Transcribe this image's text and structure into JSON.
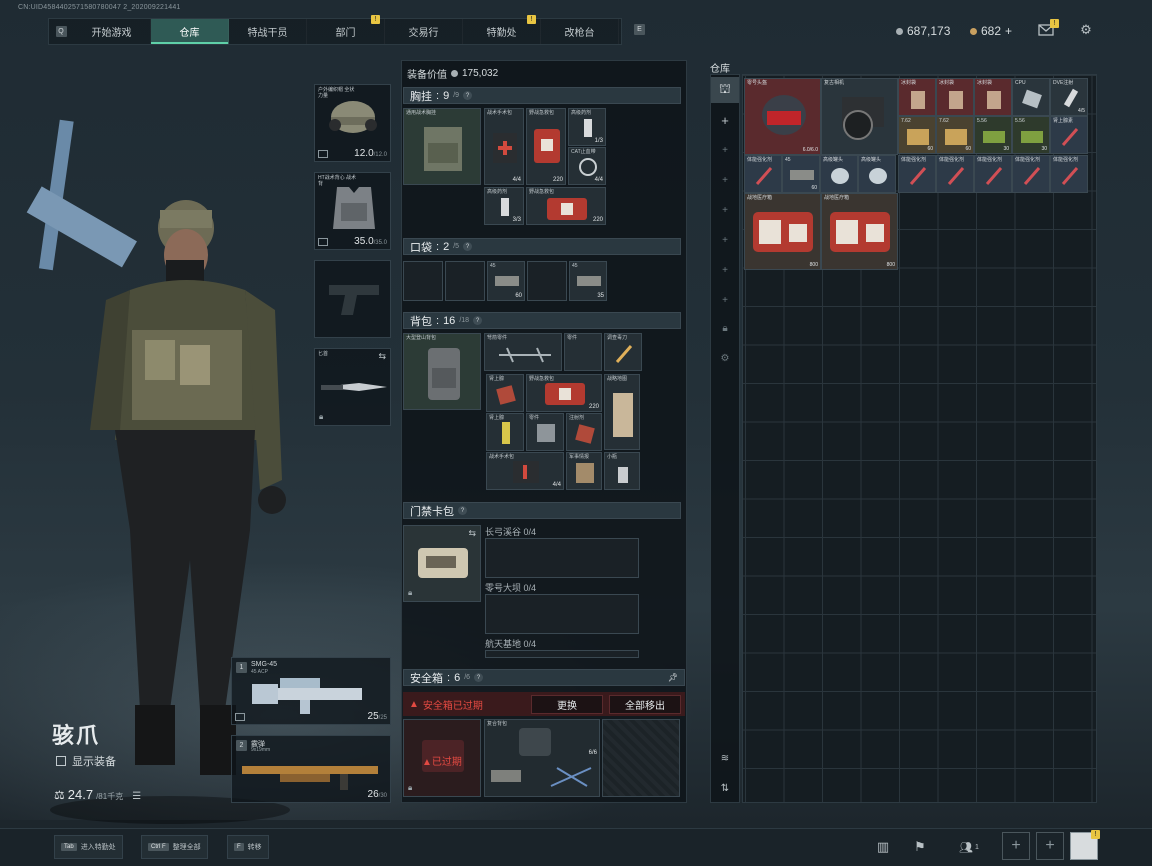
{
  "uid": "CN:UID4584402571580780047 2_202009221441",
  "nav": {
    "left_key": "Q",
    "right_key": "E",
    "tabs": [
      {
        "label": "开始游戏",
        "badge": ""
      },
      {
        "label": "仓库",
        "badge": ""
      },
      {
        "label": "特战干员",
        "badge": ""
      },
      {
        "label": "部门",
        "badge": "!"
      },
      {
        "label": "交易行",
        "badge": ""
      },
      {
        "label": "特勤处",
        "badge": "!"
      },
      {
        "label": "改枪台",
        "badge": ""
      }
    ],
    "active_tab": "仓库"
  },
  "currency": {
    "silver": "687,173",
    "gold": "682",
    "gold_plus": "+",
    "mail_badge": "!"
  },
  "character": {
    "name": "骇爪",
    "show_gear_label": "显示装备",
    "weight_current": "24.7",
    "weight_max": "/81千克"
  },
  "gear": {
    "helmet": {
      "label": "户外编织帽 全状力量",
      "value": "12.0",
      "max": "/12.0"
    },
    "armor": {
      "label": "HT战术背心 战术背",
      "value": "35.0",
      "max": "/35.0"
    },
    "melee": {
      "label": "匕首"
    },
    "primary": {
      "label": "SMG-45",
      "sub": "45 ACP",
      "ammo": "25",
      "max": "/25"
    },
    "secondary": {
      "label": "霰弹",
      "sub": "9x19mm",
      "ammo": "26",
      "max": "/30"
    }
  },
  "loadout": {
    "value_label": "装备价值",
    "value": "175,032",
    "chest": {
      "label": "胸挂",
      "count": "9",
      "max": "/9"
    },
    "pocket": {
      "label": "口袋",
      "count": "2",
      "max": "/5"
    },
    "backpack": {
      "label": "背包",
      "count": "16",
      "max": "/18"
    },
    "keycard": {
      "label": "门禁卡包"
    },
    "keys": [
      {
        "name": "长弓溪谷",
        "count": "0/4"
      },
      {
        "name": "零号大坝",
        "count": "0/4"
      },
      {
        "name": "航天基地",
        "count": "0/4"
      }
    ],
    "safebox": {
      "label": "安全箱",
      "count": "6",
      "max": "/6",
      "expired_msg": "安全箱已过期",
      "replace_btn": "更换",
      "move_all_btn": "全部移出",
      "expired_tag": "已过期"
    },
    "chest_items": [
      {
        "name": "通用战术胸挂",
        "n": ""
      },
      {
        "name": "战术手术包",
        "n": "4/4"
      },
      {
        "name": "野战急救包",
        "n": "220"
      },
      {
        "name": "高级药剂",
        "n": "1/3"
      },
      {
        "name": "CAT止血带",
        "n": "4/4"
      },
      {
        "name": "高级药剂",
        "n": "3/3"
      },
      {
        "name": "野战急救包",
        "n": "220"
      }
    ],
    "pocket_items": [
      {
        "name": "45",
        "n": "60"
      },
      {
        "name": "45",
        "n": "35"
      }
    ],
    "backpack_items": [
      {
        "name": "大型登山背包",
        "n": ""
      },
      {
        "name": "弩箭零件",
        "n": ""
      },
      {
        "name": "零件",
        "n": ""
      },
      {
        "name": "调查毒刀",
        "n": ""
      },
      {
        "name": "肾上腺",
        "n": ""
      },
      {
        "name": "野战急救包",
        "n": "220"
      },
      {
        "name": "战略地图",
        "n": ""
      },
      {
        "name": "肾上腺",
        "n": ""
      },
      {
        "name": "零件",
        "n": ""
      },
      {
        "name": "注射剂",
        "n": ""
      },
      {
        "name": "战术手术包",
        "n": "4/4"
      },
      {
        "name": "军事情报",
        "n": ""
      },
      {
        "name": "小瓶",
        "n": ""
      }
    ],
    "safe_items": [
      {
        "name": "复合背包",
        "n": ""
      },
      {
        "name": "弹药",
        "n": "6/6"
      }
    ]
  },
  "warehouse": {
    "title": "仓库",
    "items": [
      {
        "name": "零号头盔",
        "n": "6.0/6.0",
        "c": "red"
      },
      {
        "name": "复古相机",
        "n": "",
        "c": "dark"
      },
      {
        "name": "冰封袋",
        "n": "",
        "c": "red"
      },
      {
        "name": "冰封袋",
        "n": "",
        "c": "red"
      },
      {
        "name": "冰封袋",
        "n": "",
        "c": "red"
      },
      {
        "name": "CPU",
        "n": "",
        "c": "dark"
      },
      {
        "name": "DVE注射",
        "n": "4/5",
        "c": "dark"
      },
      {
        "name": "7.62",
        "n": "60",
        "c": "gold"
      },
      {
        "name": "7.62",
        "n": "60",
        "c": "gold"
      },
      {
        "name": "5.56",
        "n": "30",
        "c": "gold"
      },
      {
        "name": "5.56",
        "n": "30",
        "c": "gold"
      },
      {
        "name": "肾上腺素",
        "n": "",
        "c": "blue"
      },
      {
        "name": "体能强化剂",
        "n": "",
        "c": "blue"
      },
      {
        "name": "45",
        "n": "60",
        "c": "blue"
      },
      {
        "name": "高级罐头",
        "n": "",
        "c": "blue"
      },
      {
        "name": "高级罐头",
        "n": "",
        "c": "blue"
      },
      {
        "name": "体能强化剂",
        "n": "",
        "c": "blue"
      },
      {
        "name": "体能强化剂",
        "n": "",
        "c": "blue"
      },
      {
        "name": "体能强化剂",
        "n": "",
        "c": "blue"
      },
      {
        "name": "体能强化剂",
        "n": "",
        "c": "blue"
      },
      {
        "name": "体能强化剂",
        "n": "",
        "c": "blue"
      },
      {
        "name": "战地医疗箱",
        "n": "800",
        "c": "dark"
      },
      {
        "name": "战地医疗箱",
        "n": "800",
        "c": "dark"
      }
    ]
  },
  "hotkeys": [
    {
      "key": "Tab",
      "label": "进入特勤处"
    },
    {
      "key": "Ctrl F",
      "label": "整理全部"
    },
    {
      "key": "F",
      "label": "转移"
    }
  ],
  "bottom_right": {
    "friends_count": "1"
  }
}
